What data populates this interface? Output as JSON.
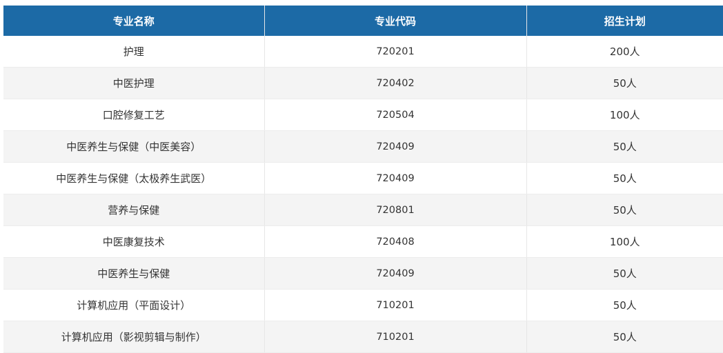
{
  "table": {
    "headers": [
      "专业名称",
      "专业代码",
      "招生计划"
    ],
    "rows": [
      {
        "name": "护理",
        "code": "720201",
        "plan": "200人"
      },
      {
        "name": "中医护理",
        "code": "720402",
        "plan": "50人"
      },
      {
        "name": "口腔修复工艺",
        "code": "720504",
        "plan": "100人"
      },
      {
        "name": "中医养生与保健（中医美容）",
        "code": "720409",
        "plan": "50人"
      },
      {
        "name": "中医养生与保健（太极养生武医）",
        "code": "720409",
        "plan": "50人"
      },
      {
        "name": "营养与保健",
        "code": "720801",
        "plan": "50人"
      },
      {
        "name": "中医康复技术",
        "code": "720408",
        "plan": "100人"
      },
      {
        "name": "中医养生与保健",
        "code": "720409",
        "plan": "50人"
      },
      {
        "name": "计算机应用（平面设计）",
        "code": "710201",
        "plan": "50人"
      },
      {
        "name": "计算机应用（影视剪辑与制作）",
        "code": "710201",
        "plan": "50人"
      }
    ]
  }
}
